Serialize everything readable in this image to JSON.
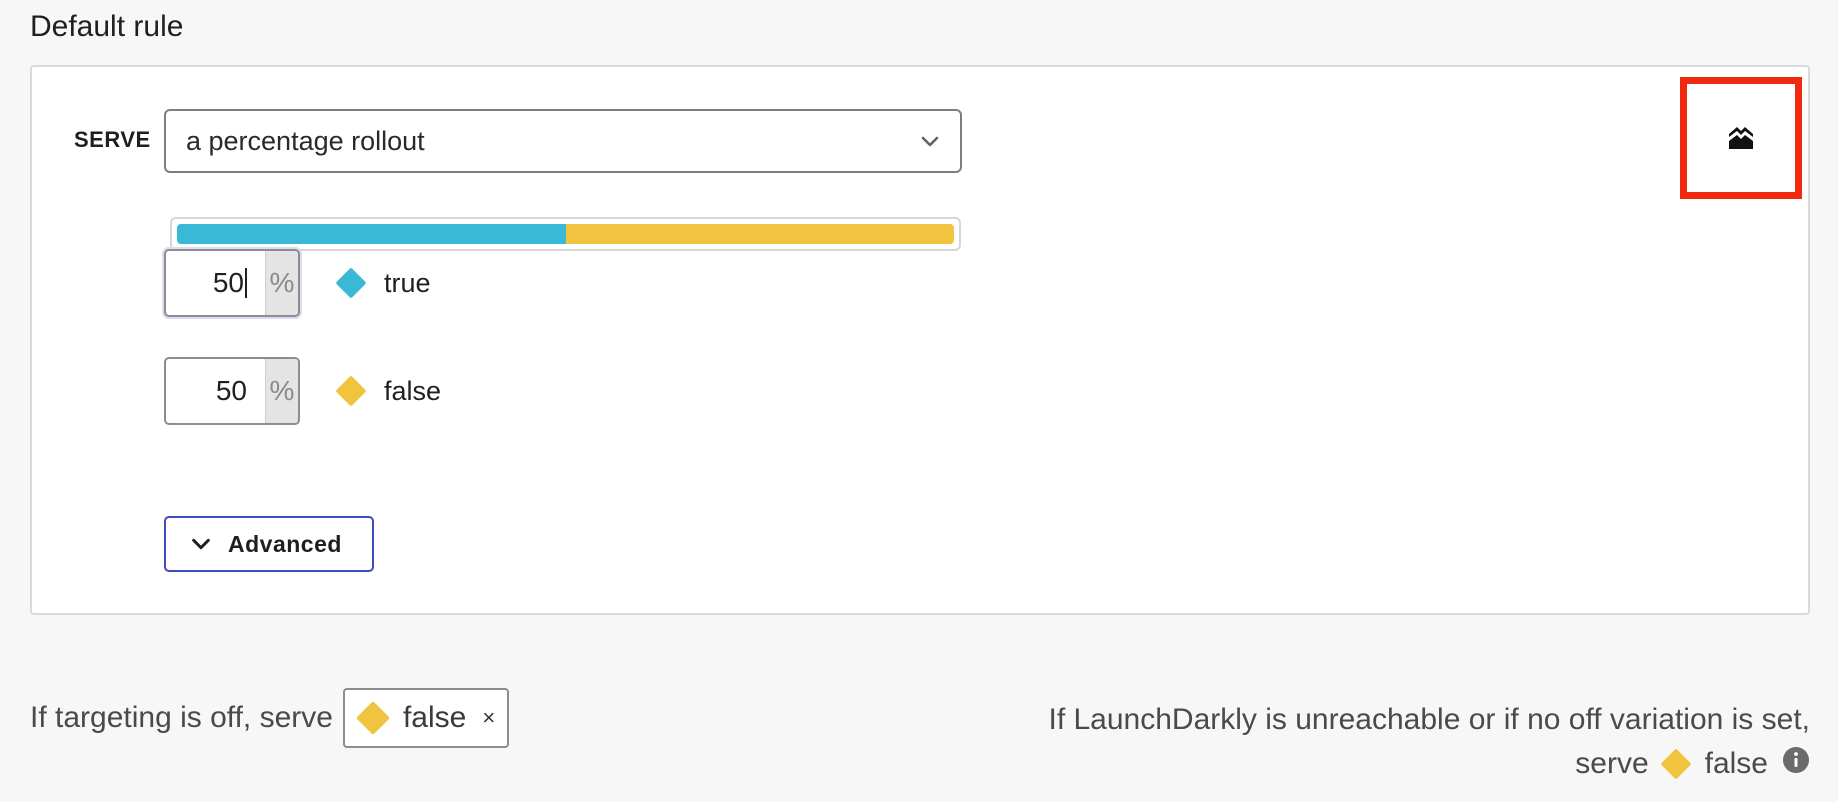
{
  "section": {
    "title": "Default rule"
  },
  "serve": {
    "label": "SERVE",
    "selected": "a percentage rollout",
    "chevron_icon": "chevron-down-icon"
  },
  "rollout": {
    "bar": [
      {
        "variation": "true",
        "percent": 50,
        "color": "#39b9d6"
      },
      {
        "variation": "false",
        "percent": 50,
        "color": "#f0c43f"
      }
    ],
    "rows": [
      {
        "value": "50",
        "suffix": "%",
        "variation": "true",
        "color": "#39b9d6",
        "focused": true
      },
      {
        "value": "50",
        "suffix": "%",
        "variation": "false",
        "color": "#f0c43f",
        "focused": false
      }
    ]
  },
  "advanced": {
    "label": "Advanced",
    "icon": "chevron-down-icon"
  },
  "toolbar": {
    "highlight_color": "#f02a10",
    "icon": "collapse-chart-icon"
  },
  "off_variation": {
    "prefix": "If targeting is off, serve",
    "value": "false",
    "color": "#f0c43f",
    "remove": "×"
  },
  "fallback": {
    "line1": "If LaunchDarkly is unreachable or if no off variation is set,",
    "serve": "serve",
    "value": "false",
    "color": "#f0c43f",
    "icon": "info-icon"
  }
}
